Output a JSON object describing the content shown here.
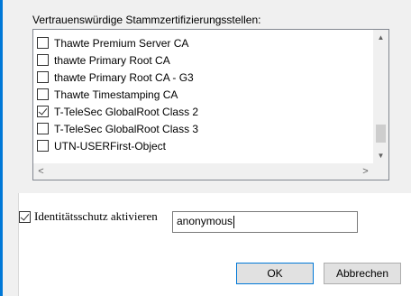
{
  "certificates": {
    "group_label": "Vertrauenswürdige Stammzertifizierungsstellen:",
    "items": [
      {
        "label": "Thawte Premium Server CA",
        "checked": false
      },
      {
        "label": "thawte Primary Root CA",
        "checked": false
      },
      {
        "label": "thawte Primary Root CA - G3",
        "checked": false
      },
      {
        "label": "Thawte Timestamping CA",
        "checked": false
      },
      {
        "label": "T-TeleSec GlobalRoot Class 2",
        "checked": true
      },
      {
        "label": "T-TeleSec GlobalRoot Class 3",
        "checked": false
      },
      {
        "label": "UTN-USERFirst-Object",
        "checked": false
      }
    ],
    "scroll_icons": {
      "up": "▲",
      "down": "▼",
      "left": "<",
      "right": ">"
    }
  },
  "identity": {
    "checkbox_label": "Identitätsschutz aktivieren",
    "checked": true,
    "value": "anonymous"
  },
  "buttons": {
    "ok": "OK",
    "cancel": "Abbrechen"
  }
}
